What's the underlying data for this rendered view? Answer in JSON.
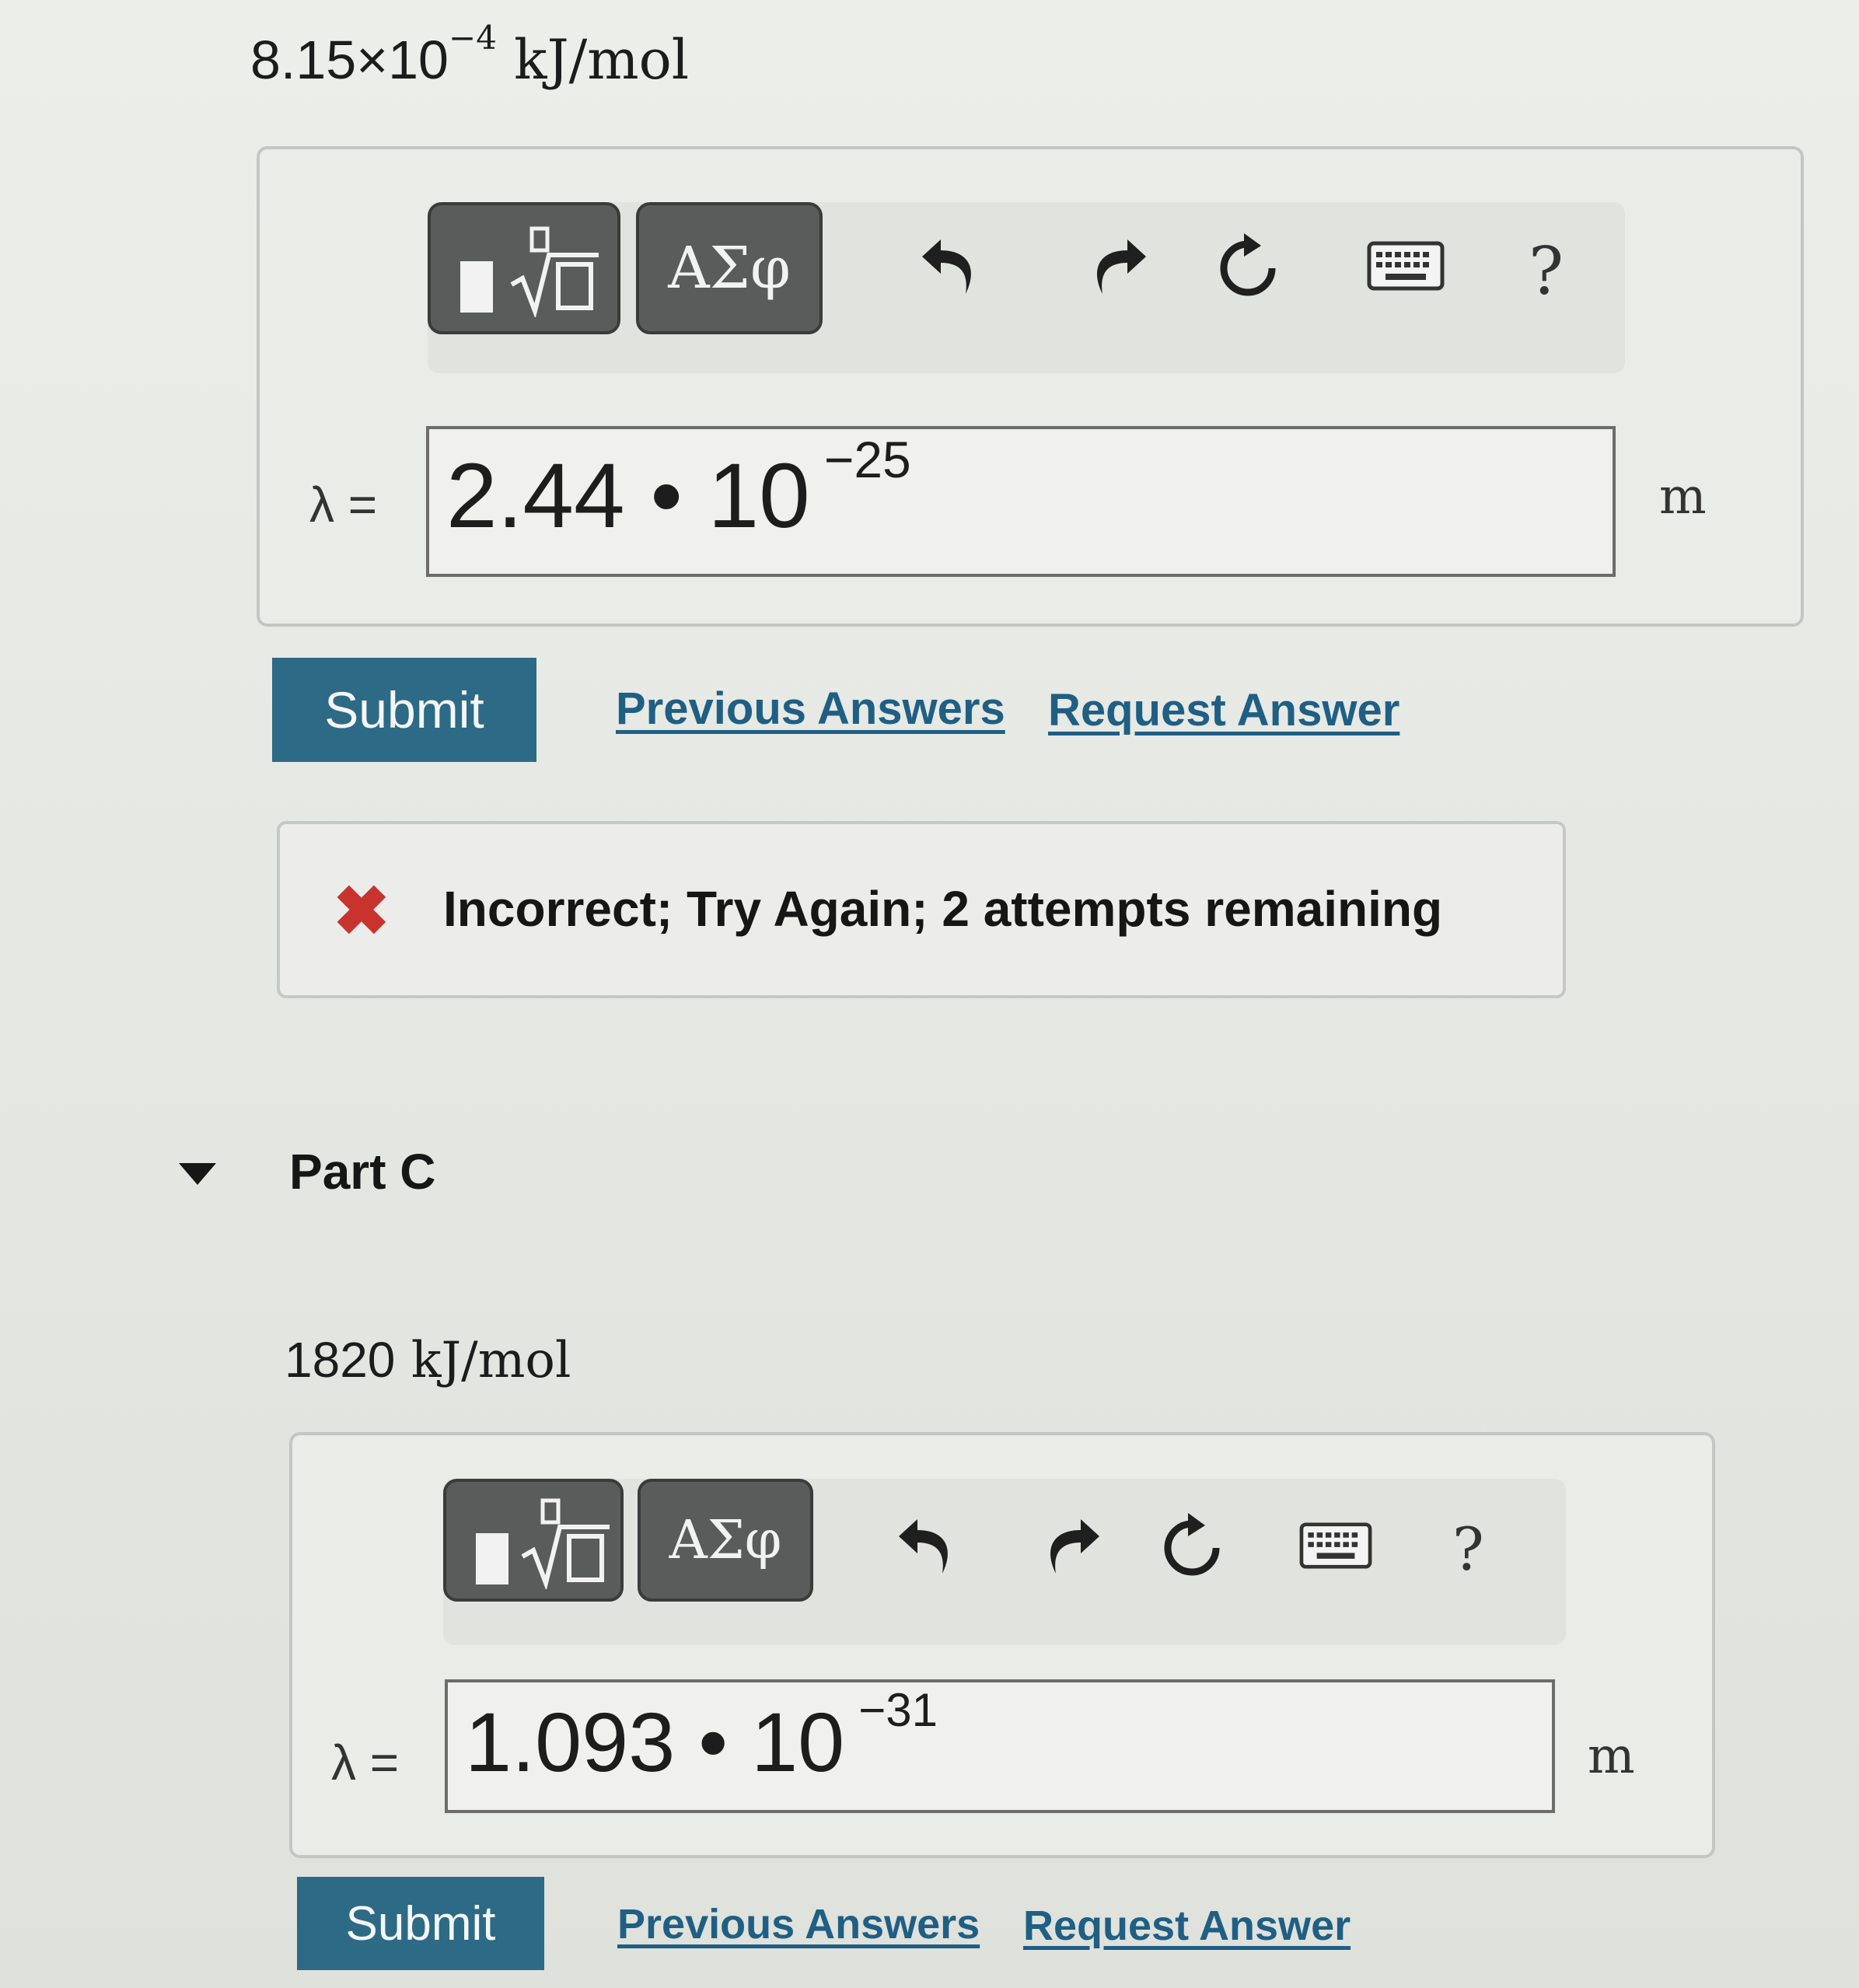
{
  "partB": {
    "question_mantissa": "8.15",
    "question_times": "×10",
    "question_exp": "−4",
    "question_unit": " kJ/mol",
    "toolbar": {
      "greek_label": "ΑΣφ",
      "help_label": "?"
    },
    "lambda_label": "λ =",
    "answer_mantissa": "2.44 • 10",
    "answer_exp": "−25",
    "unit": "m",
    "submit_label": "Submit",
    "previous_answers_label": "Previous Answers",
    "request_answer_label": "Request Answer",
    "feedback": {
      "icon": "✖",
      "text": "Incorrect; Try Again; 2 attempts remaining",
      "color": "#c8332e"
    }
  },
  "partC": {
    "title": "Part C",
    "question_value": "1820",
    "question_unit": " kJ/mol",
    "toolbar": {
      "greek_label": "ΑΣφ",
      "help_label": "?"
    },
    "lambda_label": "λ =",
    "answer_mantissa": "1.093 • 10",
    "answer_exp": "−31",
    "unit": "m",
    "submit_label": "Submit",
    "previous_answers_label": "Previous Answers",
    "request_answer_label": "Request Answer"
  },
  "colors": {
    "submit": "#2d6a86",
    "link": "#1f5f84",
    "toolbar_button": "#5a5b5b"
  }
}
